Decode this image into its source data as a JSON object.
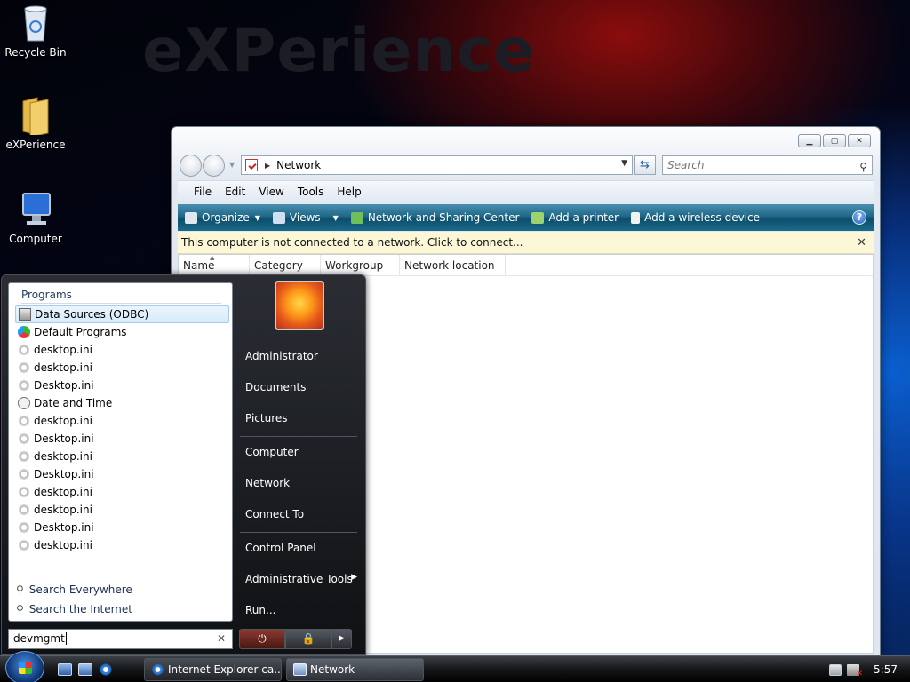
{
  "desktop": {
    "watermark": "eXPerience",
    "icons": [
      {
        "label": "Recycle Bin",
        "icon": "recycle-bin-icon"
      },
      {
        "label": "eXPerience",
        "icon": "folder-icon"
      },
      {
        "label": "Computer",
        "icon": "computer-icon"
      }
    ]
  },
  "explorer": {
    "address": "Network",
    "search_placeholder": "Search",
    "menu": [
      "File",
      "Edit",
      "View",
      "Tools",
      "Help"
    ],
    "commands": [
      {
        "label": "Organize",
        "icon": "organize-icon"
      },
      {
        "label": "Views",
        "icon": "views-icon"
      },
      {
        "label": "Network and Sharing Center",
        "icon": "network-center-icon"
      },
      {
        "label": "Add a printer",
        "icon": "printer-icon"
      },
      {
        "label": "Add a wireless device",
        "icon": "wireless-device-icon"
      }
    ],
    "info_bar": "This computer is not connected to a network. Click to connect...",
    "columns": [
      "Name",
      "Category",
      "Workgroup",
      "Network location"
    ]
  },
  "start_menu": {
    "programs_header": "Programs",
    "programs": [
      {
        "label": "Data Sources (ODBC)",
        "icon": "data-sources-icon",
        "selected": true
      },
      {
        "label": "Default Programs",
        "icon": "default-programs-icon"
      },
      {
        "label": "desktop.ini",
        "icon": "settings-file-icon"
      },
      {
        "label": "desktop.ini",
        "icon": "settings-file-icon"
      },
      {
        "label": "Desktop.ini",
        "icon": "settings-file-icon"
      },
      {
        "label": "Date and Time",
        "icon": "date-time-icon"
      },
      {
        "label": "desktop.ini",
        "icon": "settings-file-icon"
      },
      {
        "label": "Desktop.ini",
        "icon": "settings-file-icon"
      },
      {
        "label": "desktop.ini",
        "icon": "settings-file-icon"
      },
      {
        "label": "Desktop.ini",
        "icon": "settings-file-icon"
      },
      {
        "label": "desktop.ini",
        "icon": "settings-file-icon"
      },
      {
        "label": "desktop.ini",
        "icon": "settings-file-icon"
      },
      {
        "label": "Desktop.ini",
        "icon": "settings-file-icon"
      },
      {
        "label": "desktop.ini",
        "icon": "settings-file-icon"
      }
    ],
    "search_everywhere": "Search Everywhere",
    "search_internet": "Search the Internet",
    "search_value": "devmgmt",
    "right_links": [
      {
        "label": "Administrator"
      },
      {
        "label": "Documents"
      },
      {
        "label": "Pictures"
      },
      {
        "label": "Computer"
      },
      {
        "label": "Network"
      },
      {
        "label": "Connect To"
      },
      {
        "label": "Control Panel"
      },
      {
        "label": "Administrative Tools",
        "submenu": true
      },
      {
        "label": "Run..."
      }
    ]
  },
  "taskbar": {
    "tasks": [
      {
        "label": "Internet Explorer ca...",
        "icon": "internet-explorer-icon"
      },
      {
        "label": "Network",
        "icon": "network-icon"
      }
    ],
    "clock": "5:57"
  }
}
